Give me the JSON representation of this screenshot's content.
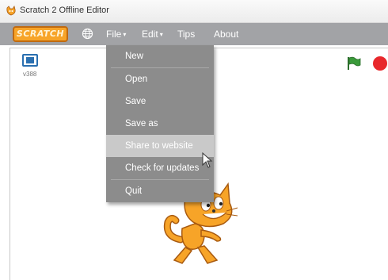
{
  "window": {
    "title": "Scratch 2 Offline Editor"
  },
  "menubar": {
    "logo_text": "SCRATCH",
    "menus": [
      {
        "label": "File",
        "caret": "▾"
      },
      {
        "label": "Edit",
        "caret": "▾"
      },
      {
        "label": "Tips"
      },
      {
        "label": "About"
      }
    ]
  },
  "stage": {
    "version": "v388"
  },
  "file_menu": {
    "items": [
      {
        "label": "New"
      },
      {
        "label": "Open"
      },
      {
        "label": "Save"
      },
      {
        "label": "Save as"
      },
      {
        "label": "Share to website",
        "hovered": true
      },
      {
        "label": "Check for updates"
      },
      {
        "label": "Quit"
      }
    ]
  },
  "colors": {
    "menubar": "#a2a3a6",
    "dropdown": "#8c8c8c",
    "hover": "#c9c9c9",
    "logo": "#f7a428",
    "green_flag": "#3a9a3a",
    "stop": "#e8272b"
  }
}
